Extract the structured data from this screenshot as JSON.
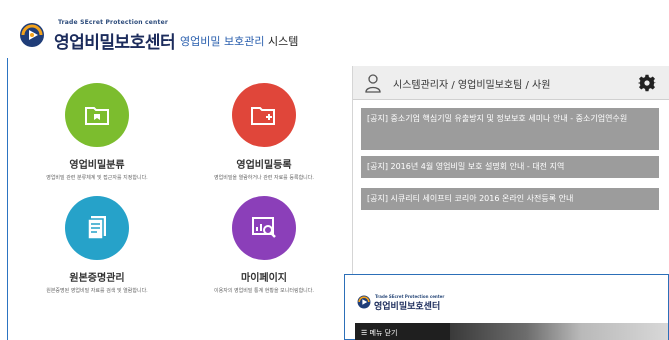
{
  "header": {
    "logo_subtitle": "Trade SEcret Protection center",
    "logo_title": "영업비밀보호센터",
    "system_highlight": "영업비밀 보호관리",
    "system_rest": " 시스템"
  },
  "tiles": [
    {
      "title": "영업비밀분류",
      "desc": "영업비밀 관련 분류체계 및 접근자를 지정합니다.",
      "color": "#7cbd2e",
      "icon": "folder-icon"
    },
    {
      "title": "영업비밀등록",
      "desc": "영업비밀을 열람하거나 관련 자료를 등록합니다.",
      "color": "#e0463a",
      "icon": "folder-plus-icon"
    },
    {
      "title": "원본증명관리",
      "desc": "원본증명된 영업비밀 자료를 검색 및 열람합니다.",
      "color": "#26a2c9",
      "icon": "document-icon"
    },
    {
      "title": "마이페이지",
      "desc": "이용자의 영업비밀 통계 현황을 모니터링합니다.",
      "color": "#8b3fb9",
      "icon": "chart-search-icon"
    }
  ],
  "panel": {
    "user_line": "시스템관리자 / 영업비밀보호팀 / 사원",
    "notices": [
      "[공지] 중소기업 핵심기밀 유출방지 및 정보보호 세미나 안내 - 중소기업연수원",
      "[공지] 2016년 4월 영업비밀 보호 설명회 안내 - 대전 지역",
      "[공지] 시큐리티 세이프티 코리아 2016 온라인 사전등록 안내"
    ]
  },
  "mobile": {
    "logo_subtitle": "Trade SEcret Protection center",
    "logo_title": "영업비밀보호센터",
    "menu_label": "☰ 메뉴 닫기"
  }
}
